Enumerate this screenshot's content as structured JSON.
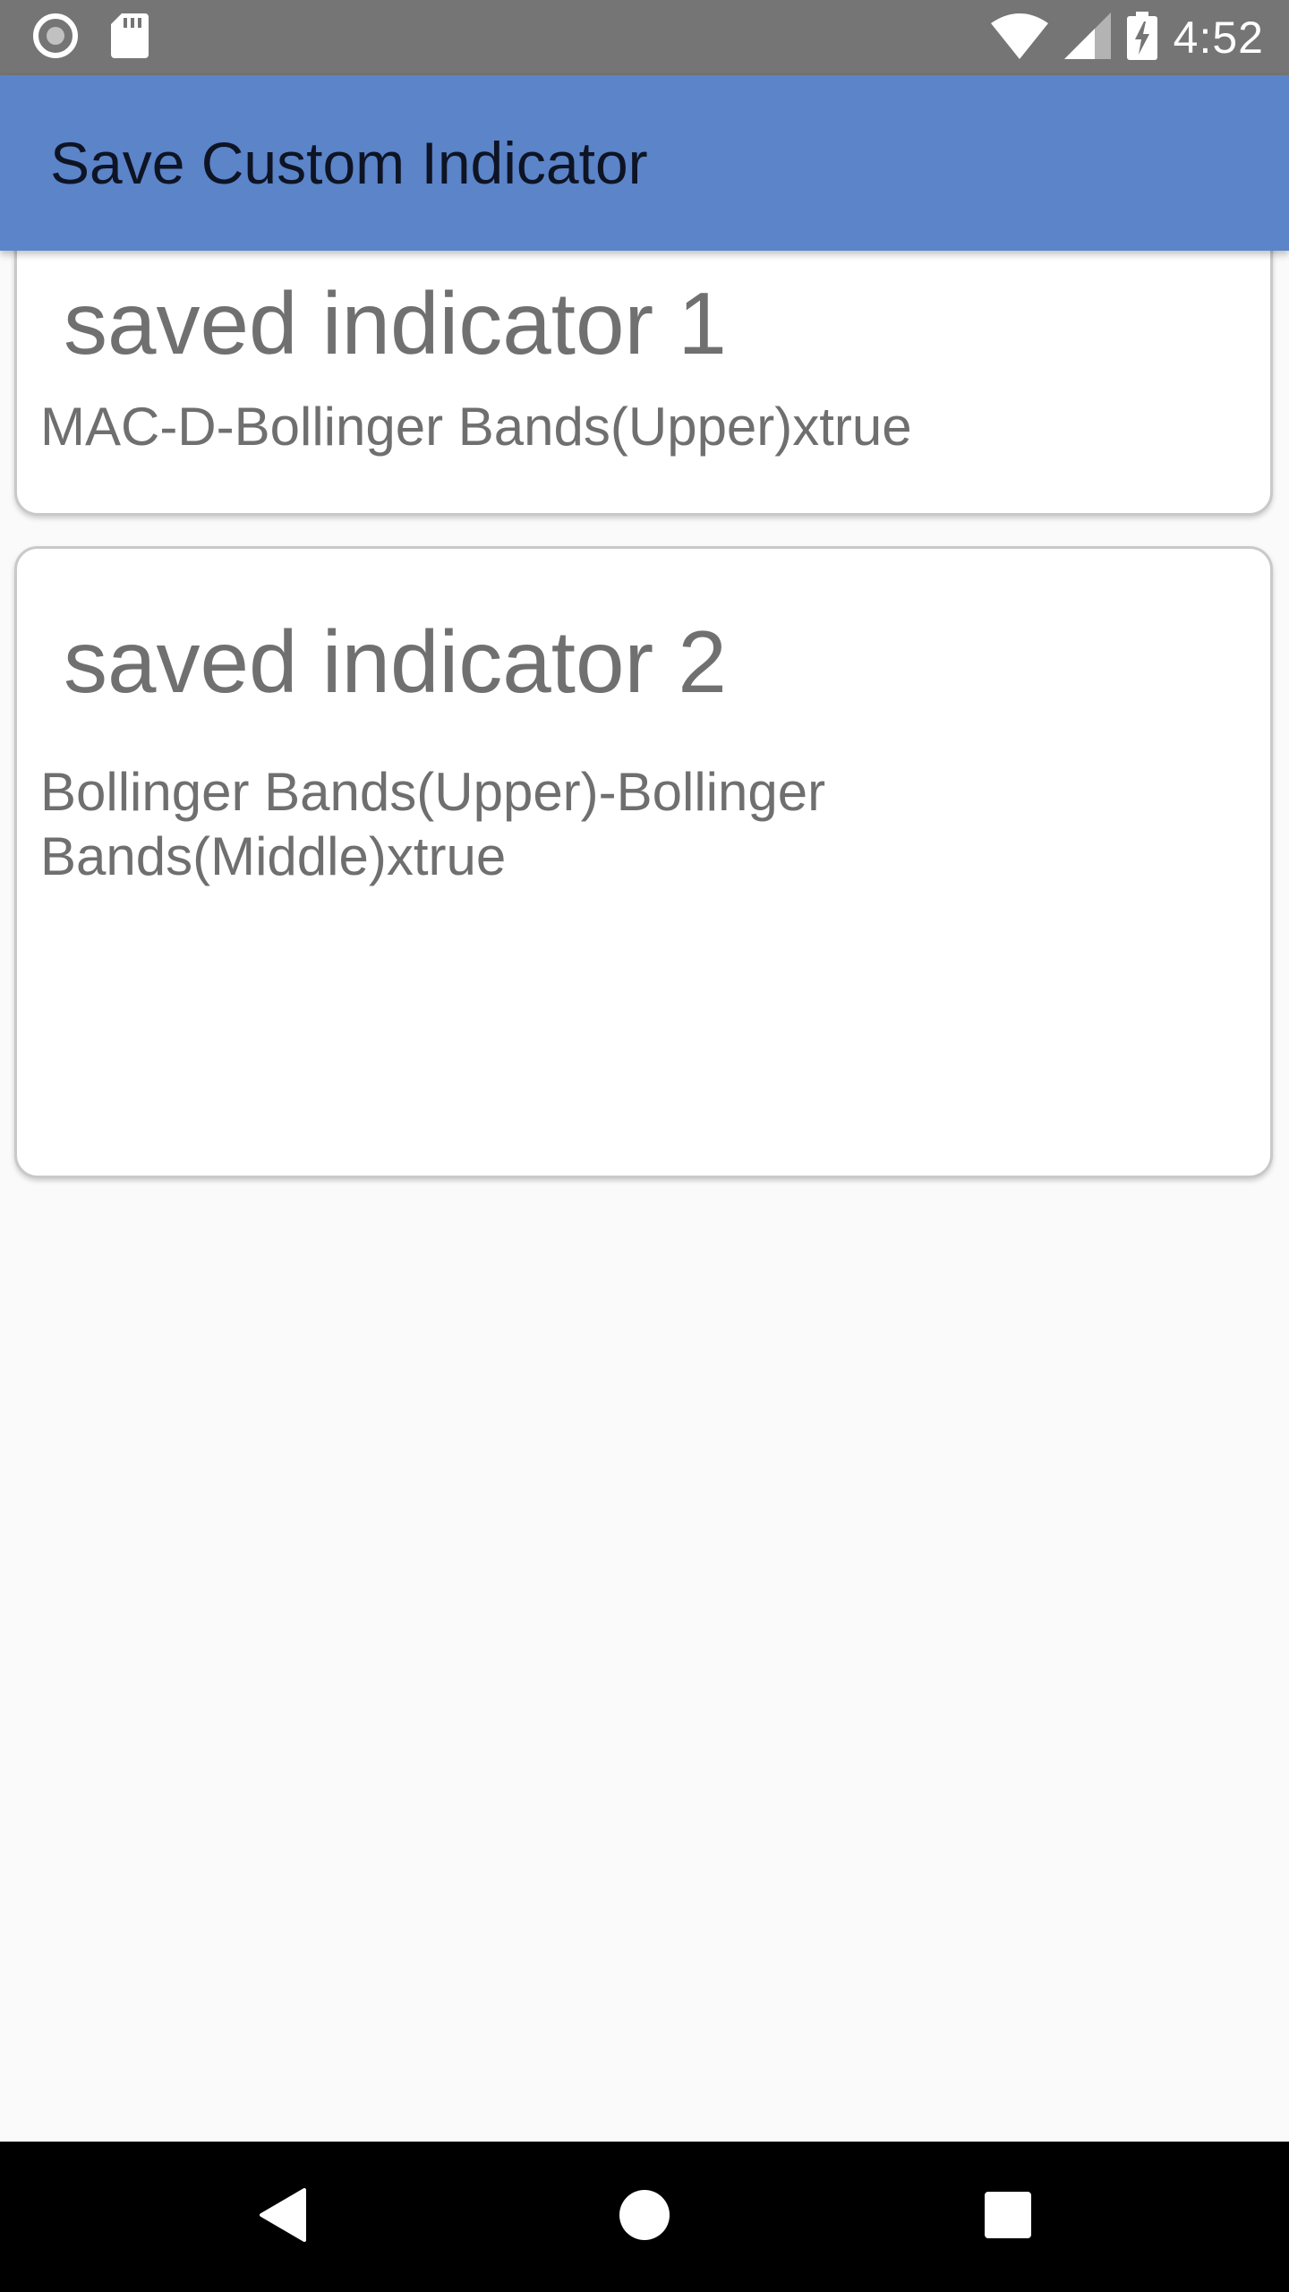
{
  "status_bar": {
    "time": "4:52",
    "left_icons": [
      "record-icon",
      "sd-card-icon"
    ],
    "right_icons": [
      "wifi-icon",
      "signal-icon",
      "battery-charging-icon"
    ]
  },
  "app_bar": {
    "title": "Save Custom Indicator",
    "color": "#5b84c9"
  },
  "indicators": [
    {
      "title": "saved indicator 1",
      "description": "MAC-D-Bollinger Bands(Upper)xtrue"
    },
    {
      "title": "saved indicator 2",
      "description": "Bollinger Bands(Upper)-Bollinger Bands(Middle)xtrue"
    }
  ],
  "nav_bar": {
    "buttons": [
      "back-icon",
      "home-icon",
      "recents-icon"
    ]
  }
}
